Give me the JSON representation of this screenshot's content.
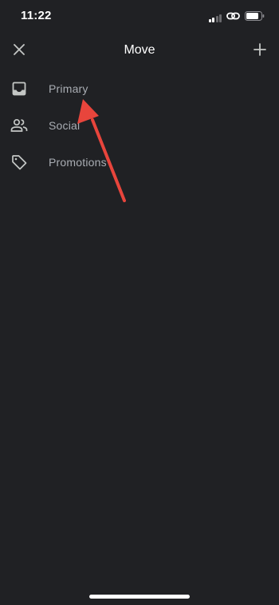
{
  "status_bar": {
    "time": "11:22"
  },
  "app_bar": {
    "title": "Move",
    "close_icon": "close-icon",
    "add_icon": "plus-icon"
  },
  "labels": [
    {
      "label": "Primary",
      "icon": "inbox-icon"
    },
    {
      "label": "Social",
      "icon": "people-icon"
    },
    {
      "label": "Promotions",
      "icon": "tag-icon"
    }
  ],
  "colors": {
    "background": "#202124",
    "label_text": "#a9adb3",
    "icon": "#c4c7c5",
    "annotation_arrow": "#e8453c"
  }
}
